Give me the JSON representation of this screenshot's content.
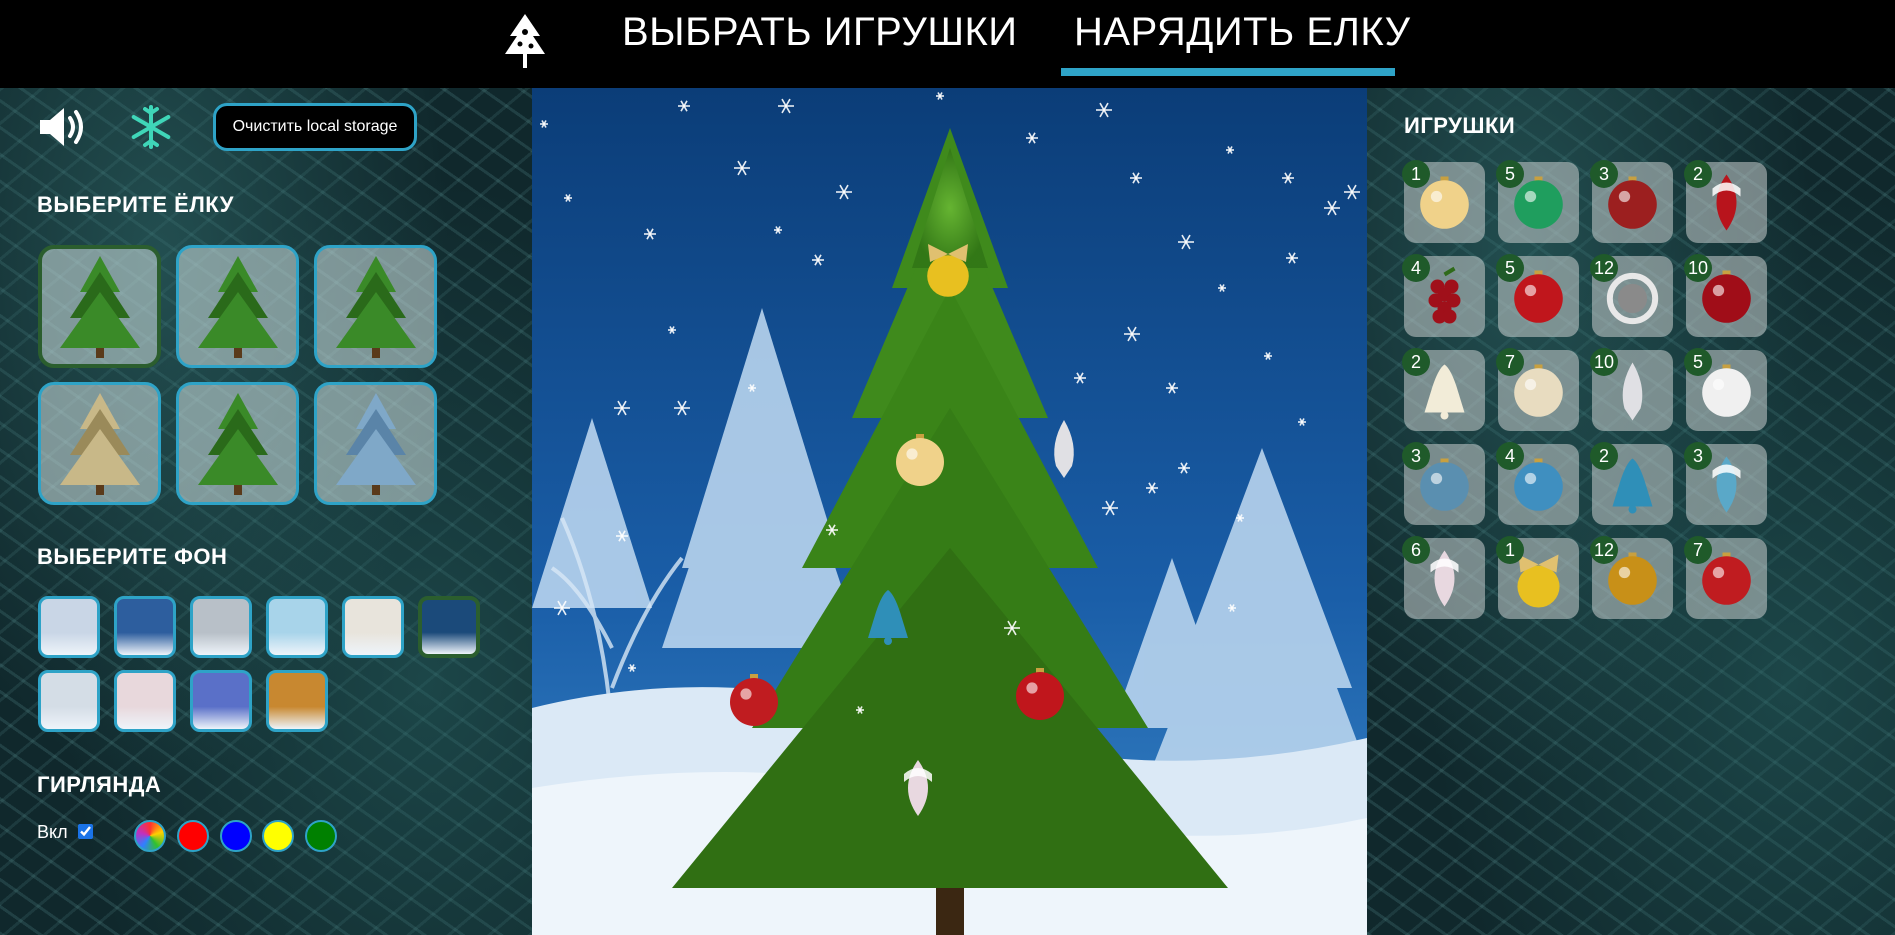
{
  "header": {
    "nav": [
      {
        "label": "ВЫБРАТЬ ИГРУШКИ"
      },
      {
        "label": "НАРЯДИТЬ ЕЛКУ"
      }
    ]
  },
  "controls": {
    "sound_icon": "speaker-on-icon",
    "snow_icon": "snowflake-icon",
    "clear_storage_label": "Очистить local storage"
  },
  "trees": {
    "title": "ВЫБЕРИТЕ ЁЛКУ",
    "items": [
      {
        "variant": "green",
        "selected": true
      },
      {
        "variant": "green",
        "selected": false
      },
      {
        "variant": "green",
        "selected": false
      },
      {
        "variant": "golden",
        "selected": false
      },
      {
        "variant": "green",
        "selected": false
      },
      {
        "variant": "blue",
        "selected": false
      }
    ]
  },
  "backgrounds": {
    "title": "ВЫБЕРИТЕ ФОН",
    "items": [
      {
        "color": "#c9d6e6",
        "selected": false
      },
      {
        "color": "#2d5e9e",
        "selected": false
      },
      {
        "color": "#b8c0c8",
        "selected": false
      },
      {
        "color": "#a8d4ea",
        "selected": false
      },
      {
        "color": "#e8e4dc",
        "selected": false
      },
      {
        "color": "#1b4a7a",
        "selected": true
      },
      {
        "color": "#d4dde6",
        "selected": false
      },
      {
        "color": "#e8d8dc",
        "selected": false
      },
      {
        "color": "#5a70c8",
        "selected": false
      },
      {
        "color": "#c88830",
        "selected": false
      }
    ]
  },
  "garland": {
    "title": "ГИРЛЯНДА",
    "toggle_label": "Вкл",
    "enabled": true,
    "colors": [
      "multicolor",
      "#ff0000",
      "#0000ff",
      "#ffff00",
      "#008000"
    ]
  },
  "toys": {
    "title": "ИГРУШКИ",
    "items": [
      {
        "count": "1",
        "kind": "ball",
        "color": "#f0d28a"
      },
      {
        "count": "5",
        "kind": "ball",
        "color": "#1f9e5e"
      },
      {
        "count": "3",
        "kind": "ball",
        "color": "#9c1f1f"
      },
      {
        "count": "2",
        "kind": "drop",
        "color": "#b8141c"
      },
      {
        "count": "4",
        "kind": "grapes",
        "color": "#a0101a"
      },
      {
        "count": "5",
        "kind": "ball",
        "color": "#c0161c"
      },
      {
        "count": "12",
        "kind": "ring",
        "color": "#e8e8e8"
      },
      {
        "count": "10",
        "kind": "ball",
        "color": "#a00d18"
      },
      {
        "count": "2",
        "kind": "bell",
        "color": "#f2ecd8"
      },
      {
        "count": "7",
        "kind": "ball",
        "color": "#e8dcc0"
      },
      {
        "count": "10",
        "kind": "cone",
        "color": "#e0e0e4"
      },
      {
        "count": "5",
        "kind": "ball",
        "color": "#f0f0f0"
      },
      {
        "count": "3",
        "kind": "ball",
        "color": "#5a8fb0"
      },
      {
        "count": "4",
        "kind": "ball",
        "color": "#3f8fc0"
      },
      {
        "count": "2",
        "kind": "bell",
        "color": "#2f8fb8"
      },
      {
        "count": "3",
        "kind": "drop",
        "color": "#5aa8c8"
      },
      {
        "count": "6",
        "kind": "drop",
        "color": "#e8d8e0"
      },
      {
        "count": "1",
        "kind": "bow",
        "color": "#e8c020"
      },
      {
        "count": "12",
        "kind": "ball",
        "color": "#c89018"
      },
      {
        "count": "7",
        "kind": "ball",
        "color": "#c01c20"
      }
    ]
  },
  "scene": {
    "sky_color": "#0b3d78",
    "tree_color": "#3f8a1c",
    "decorations": [
      {
        "kind": "bow",
        "color": "#e8c020"
      },
      {
        "kind": "ball",
        "color": "#f0d28a"
      },
      {
        "kind": "cone",
        "color": "#e0e0e4"
      },
      {
        "kind": "bell",
        "color": "#2f8fb8"
      },
      {
        "kind": "ball",
        "color": "#c01c20"
      },
      {
        "kind": "ball",
        "color": "#c0161c"
      },
      {
        "kind": "drop",
        "color": "#e8d8e0"
      }
    ]
  }
}
